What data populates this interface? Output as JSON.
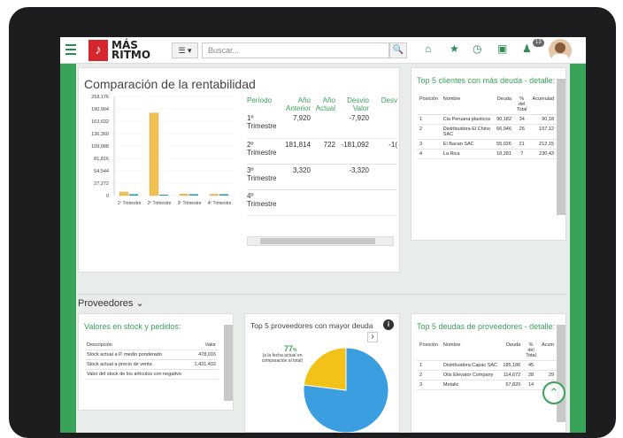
{
  "header": {
    "logo_glyph": "♪",
    "brand_line1": "MÁS",
    "brand_line2": "RITMO",
    "list_button": "☰ ▾",
    "search_placeholder": "Buscar...",
    "search_button": "🔍",
    "nav_icons": [
      "home-icon",
      "star-icon",
      "clock-icon",
      "calendar-icon",
      "bell-icon"
    ],
    "home": "⌂",
    "star": "★",
    "clock": "◷",
    "calendar": "▣",
    "bell": "♟",
    "notif_count": "13"
  },
  "rentabilidad": {
    "title": "Comparación de la rentabilidad",
    "columns": [
      "Período",
      "Año Anterior",
      "Año Actual",
      "Desvío Valor",
      "Desv"
    ],
    "rows": [
      {
        "periodo": "1º Trimestre",
        "anterior": "7,920",
        "actual": "",
        "desvio": "-7,920",
        "desv": ""
      },
      {
        "periodo": "2º Trimestre",
        "anterior": "181,814",
        "actual": "722",
        "desvio": "-181,092",
        "desv": "-1("
      },
      {
        "periodo": "3º Trimestre",
        "anterior": "3,320",
        "actual": "",
        "desvio": "-3,320",
        "desv": ""
      },
      {
        "periodo": "4º Trimestre",
        "anterior": "",
        "actual": "",
        "desvio": "",
        "desv": ""
      }
    ]
  },
  "chart_data": {
    "type": "bar",
    "categories": [
      "1º Trimestre",
      "2º Trimestre",
      "3º Trimestre",
      "4º Trimestre"
    ],
    "category_labels": [
      "1º Trimestre",
      "2º Trimestre",
      "3º Trimestre",
      "4º Trimestre"
    ],
    "series": [
      {
        "values": [
          7920,
          181814,
          3320,
          0
        ],
        "color": "#f0c050"
      },
      {
        "values": [
          0,
          722,
          0,
          0
        ],
        "color": "#1a9bb0"
      }
    ],
    "yticks": [
      "218,176",
      "190,904",
      "163,632",
      "136,360",
      "109,088",
      "81,816",
      "54,544",
      "27,272",
      "0"
    ],
    "ylim": [
      0,
      218176
    ]
  },
  "clientes": {
    "title": "Top 5 clientes con más deuda - detalle:",
    "columns": [
      "Posición",
      "Nombre",
      "Deuda",
      "% del Total",
      "Acumulad"
    ],
    "rows": [
      {
        "pos": "1",
        "nombre": "Cia Peruana plasticos",
        "deuda": "90,182",
        "pct": "34",
        "acum": "90,18"
      },
      {
        "pos": "2",
        "nombre": "Distribuidora El Chino SAC",
        "deuda": "66,946",
        "pct": "26",
        "acum": "157,12"
      },
      {
        "pos": "3",
        "nombre": "El Bacan SAC",
        "deuda": "55,026",
        "pct": "21",
        "acum": "212,15"
      },
      {
        "pos": "4",
        "nombre": "La Rica",
        "deuda": "18,281",
        "pct": "7",
        "acum": "230,43"
      }
    ]
  },
  "proveedores": {
    "heading": "Proveedores",
    "caret": "⌄",
    "stock": {
      "title": "Valores en stock y pedidos:",
      "columns": [
        "Descripción",
        "Valor"
      ],
      "rows": [
        {
          "desc": "Stock actual a P. medio ponderado",
          "valor": "478,016"
        },
        {
          "desc": "Stock actual a precio de venta",
          "valor": "1,431,432"
        },
        {
          "desc": "Valor del stock de los artículos con negativo",
          "valor": ""
        }
      ]
    },
    "top5": {
      "title": "Top 5 proveedores con mayor deuda",
      "info": "i",
      "next": "›",
      "pct": "77",
      "pct_sign": "%",
      "note": "(a la fecha actual en comparación al total)",
      "pie": [
        {
          "value": 77,
          "color": "#3b9ee0"
        },
        {
          "value": 23,
          "color": "#f2c218"
        }
      ]
    },
    "deudas": {
      "title": "Top 5 deudas de proveedores - detalle:",
      "columns": [
        "Posición",
        "Nombre",
        "Deuda",
        "% del Total",
        "Acum"
      ],
      "rows": [
        {
          "pos": "1",
          "nombre": "Distribuidora Capac SAC",
          "deuda": "185,186",
          "pct": "45",
          "acum": ""
        },
        {
          "pos": "2",
          "nombre": "Otis Elevator Company",
          "deuda": "114,672",
          "pct": "28",
          "acum": "29"
        },
        {
          "pos": "3",
          "nombre": "Metalic",
          "deuda": "57,820",
          "pct": "14",
          "acum": "35"
        }
      ]
    }
  }
}
